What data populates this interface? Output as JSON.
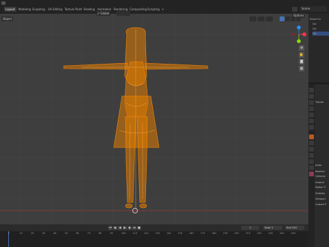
{
  "workspaces": [
    "Layout",
    "Modeling",
    "Sculpting",
    "UV Editing",
    "Texture Paint",
    "Shading",
    "Animation",
    "Rendering",
    "Compositing",
    "Scripting"
  ],
  "add_tab_symbol": "+",
  "scene_name": "Scene",
  "viewport": {
    "mode_label": "Object",
    "orientation_label": "Global",
    "options_label": "Options"
  },
  "gizmo_axes": {
    "x": "X",
    "y": "Y",
    "z": "Z"
  },
  "colors": {
    "selection_orange": "#ff8a00",
    "viewport_bg": "#3e3e3e",
    "accent_blue": "#4772b3",
    "axis_x": "#ff3352",
    "axis_y": "#8bdc00",
    "axis_z": "#2890ff"
  },
  "outliner": {
    "items": [
      "Scene Co",
      "Col",
      "Col",
      "Col"
    ]
  },
  "properties": {
    "rows": [
      "Transfo",
      "Delta",
      "Relation",
      "Collectio",
      "Instanci",
      "Motion P",
      "Visibility",
      "Viewport",
      "Custom P"
    ]
  },
  "timeline": {
    "current_frame": "1",
    "start_label": "Start",
    "start_value": "1",
    "end_label": "End",
    "end_value": "250",
    "ruler": [
      "0",
      "10",
      "20",
      "30",
      "40",
      "50",
      "60",
      "70",
      "80",
      "90",
      "100",
      "110",
      "120",
      "130",
      "140",
      "150",
      "160",
      "170",
      "180",
      "190",
      "200",
      "210",
      "220",
      "230",
      "240",
      "250"
    ]
  },
  "icons": [
    "editor-type-icon",
    "select-mode-icon",
    "transform-orientation-icon",
    "pivot-icon",
    "snap-icon",
    "overlay-icon",
    "shading-wireframe-icon",
    "shading-solid-icon",
    "shading-material-icon",
    "shading-rendered-icon",
    "zoom-icon",
    "pan-icon",
    "camera-icon",
    "ortho-icon",
    "jump-start-icon",
    "prev-keyframe-icon",
    "play-reverse-icon",
    "play-icon",
    "next-keyframe-icon",
    "jump-end-icon",
    "record-icon"
  ]
}
